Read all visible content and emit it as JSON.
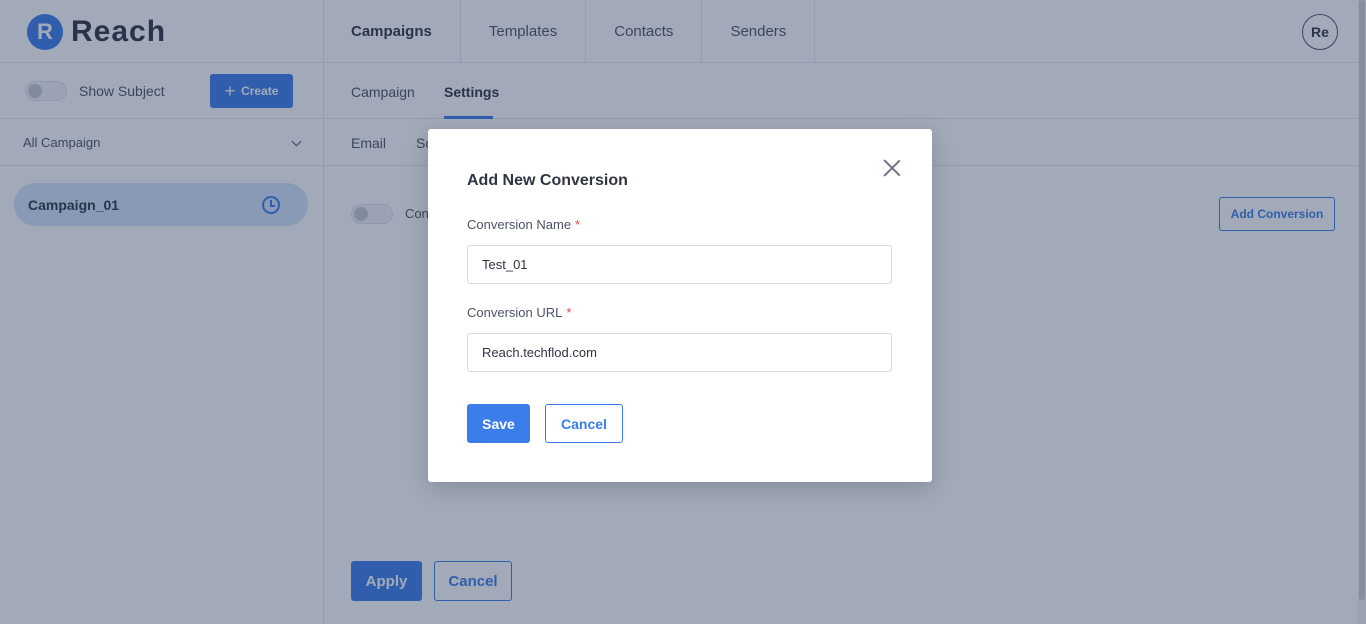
{
  "app": {
    "logo_letter": "R",
    "name": "Reach",
    "accent_color": "#3b7de9"
  },
  "topnav": {
    "items": [
      {
        "label": "Campaigns",
        "active": true
      },
      {
        "label": "Templates",
        "active": false
      },
      {
        "label": "Contacts",
        "active": false
      },
      {
        "label": "Senders",
        "active": false
      }
    ],
    "avatar_initials": "Re"
  },
  "sidebar": {
    "show_subject_label": "Show Subject",
    "show_subject_on": false,
    "create_icon": "plus-icon",
    "create_label": "Create",
    "filter_label": "All Campaign",
    "campaigns": [
      {
        "name": "Campaign_01",
        "icon": "clock-icon"
      }
    ]
  },
  "main": {
    "subtabs": [
      {
        "label": "Campaign",
        "active": false
      },
      {
        "label": "Settings",
        "active": true
      }
    ],
    "settings_tabs": [
      {
        "label": "Email"
      },
      {
        "label": "Sc"
      }
    ],
    "conversion_toggle_label": "Con",
    "add_conversion_label": "Add Conversion",
    "apply_label": "Apply",
    "cancel_label": "Cancel"
  },
  "modal": {
    "title": "Add New Conversion",
    "close_icon": "close-icon",
    "name_label": "Conversion Name",
    "name_value": "Test_01",
    "url_label": "Conversion URL",
    "url_value": "Reach.techflod.com",
    "required_mark": "*",
    "save_label": "Save",
    "cancel_label": "Cancel"
  }
}
